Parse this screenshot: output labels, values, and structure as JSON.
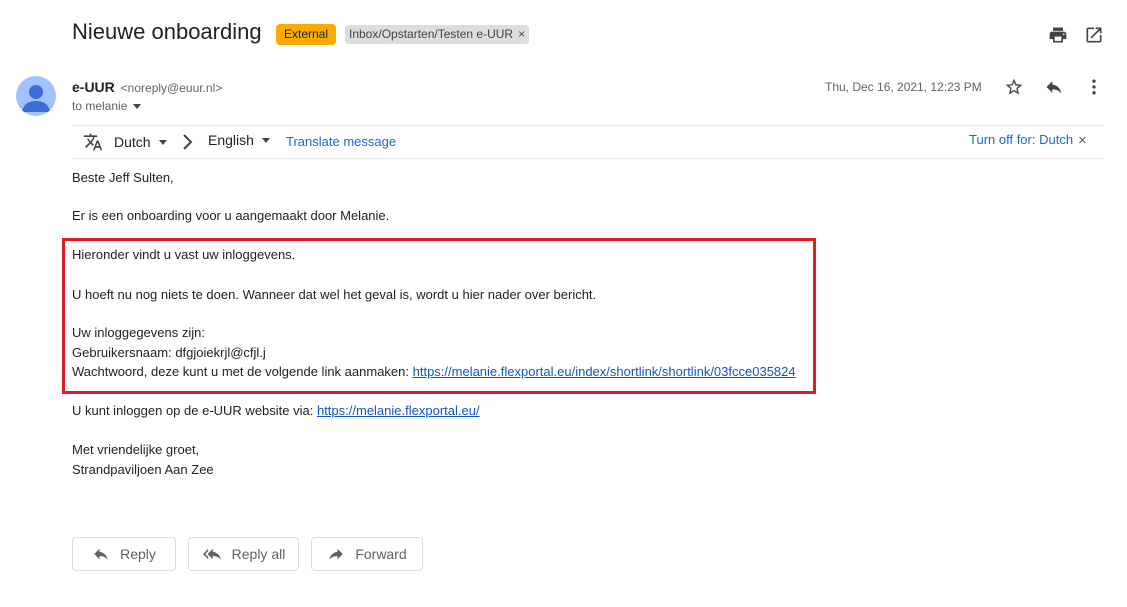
{
  "subject": "Nieuwe onboarding",
  "labels": {
    "external": "External",
    "folder": "Inbox/Opstarten/Testen e-UUR",
    "remove": "×"
  },
  "sender": {
    "name": "e-UUR",
    "email": "<noreply@euur.nl>",
    "to": "to melanie"
  },
  "date": "Thu, Dec 16, 2021, 12:23 PM",
  "translate": {
    "from_lang": "Dutch",
    "to_lang": "English",
    "translate_link": "Translate message",
    "turn_off": "Turn off for: Dutch",
    "close": "×"
  },
  "body": {
    "greeting": "Beste Jeff Sulten,",
    "line1": "Er is een onboarding voor u aangemaakt door Melanie.",
    "line2": "Hieronder vindt u vast uw inloggevens.",
    "line3": "U hoeft nu nog niets te doen. Wanneer dat wel het geval is, wordt u hier nader over bericht.",
    "line4": "Uw inloggegevens zijn:",
    "line5": "Gebruikersnaam: dfgjoiekrjl@cfjl.j",
    "line6_prefix": "Wachtwoord, deze kunt u met de volgende link aanmaken: ",
    "line6_link": "https://melanie.flexportal.eu/index/shortlink/shortlink/03fcce035824",
    "line7_prefix": "U kunt inloggen op de e-UUR website via: ",
    "line7_link": "https://melanie.flexportal.eu/",
    "closing1": "Met vriendelijke groet,",
    "closing2": "Strandpaviljoen Aan Zee"
  },
  "actions": {
    "reply": "Reply",
    "reply_all": "Reply all",
    "forward": "Forward"
  },
  "colors": {
    "external_label": "#f9ab00",
    "highlight_box": "#e31b23",
    "link": "#1155cc",
    "avatar": "#a0c3ff"
  }
}
